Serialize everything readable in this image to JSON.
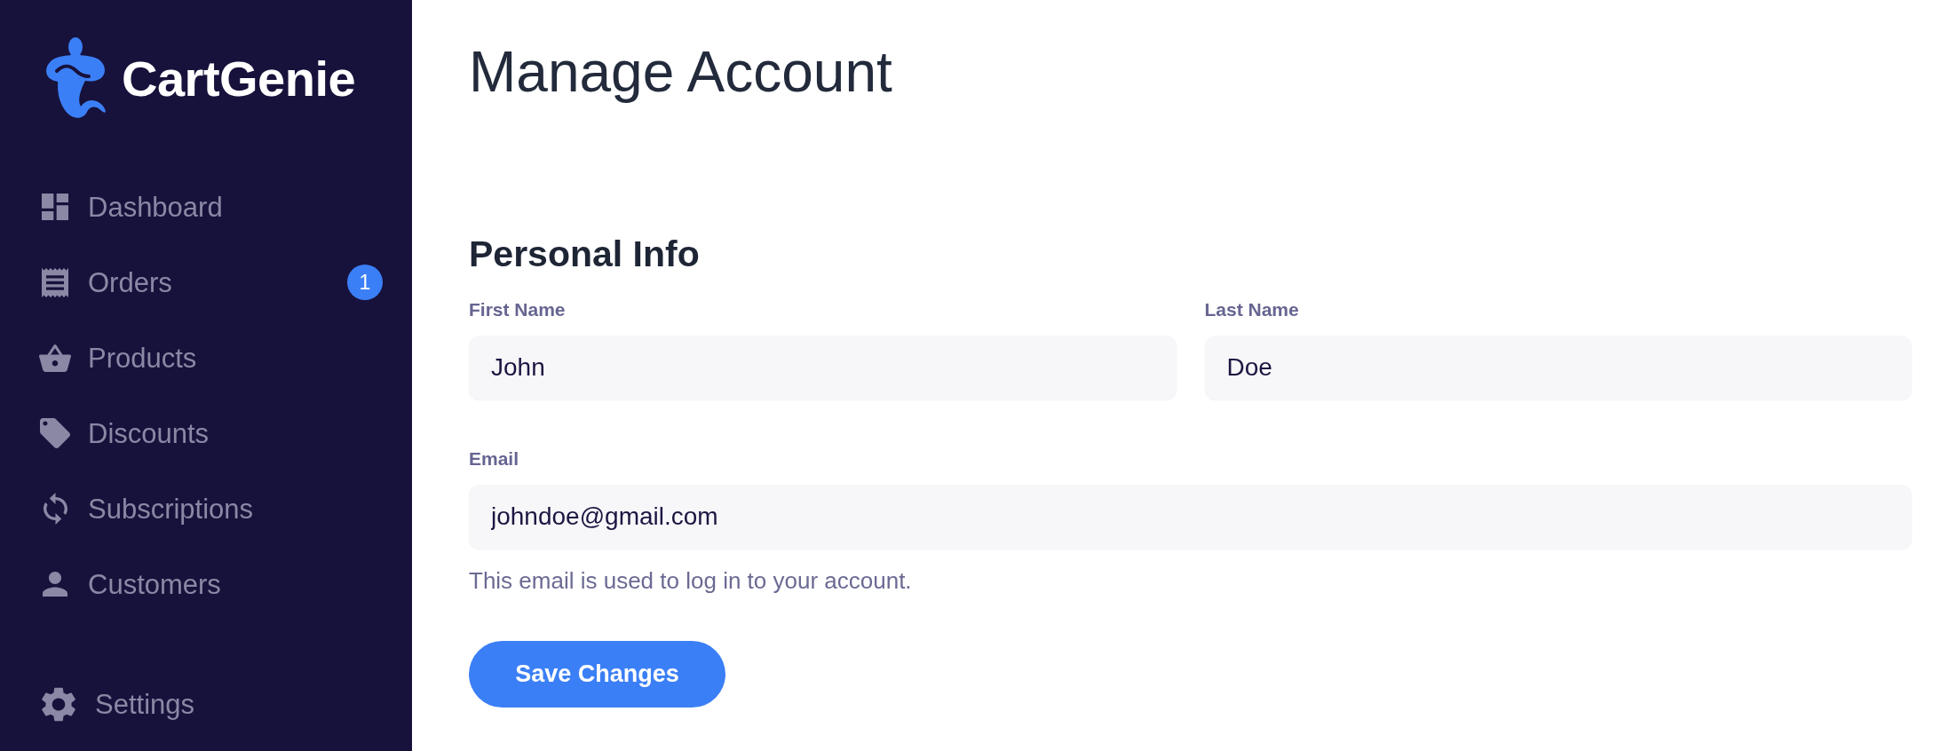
{
  "sidebar": {
    "logo": {
      "text": "CartGenie"
    },
    "items": [
      {
        "label": "Dashboard",
        "selected": false
      },
      {
        "label": "Orders",
        "selected": false,
        "badge": "1"
      },
      {
        "label": "Products",
        "selected": false
      },
      {
        "label": "Discounts",
        "selected": false
      },
      {
        "label": "Subscriptions",
        "selected": false
      },
      {
        "label": "Customers",
        "selected": false
      }
    ],
    "footer_items": [
      {
        "label": "Settings",
        "selected": false
      }
    ]
  },
  "page": {
    "title": "Manage Account",
    "section": {
      "title": "Personal Info",
      "rows": [
        {
          "fields": [
            {
              "label": "First Name",
              "value": "John"
            },
            {
              "label": "Last Name",
              "value": "Doe"
            }
          ]
        },
        {
          "fields": [
            {
              "label": "Email",
              "value": "johndoe@gmail.com",
              "help": "This email is used to log in to your account."
            }
          ]
        }
      ]
    },
    "save_button": "Save Changes"
  }
}
